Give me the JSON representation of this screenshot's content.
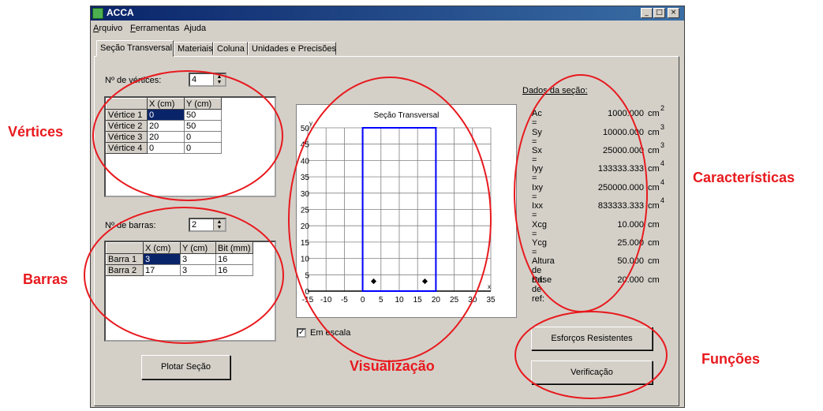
{
  "window": {
    "title": "ACCA",
    "min": "_",
    "max": "□",
    "close": "×"
  },
  "menu": [
    {
      "u": "A",
      "rest": "rquivo"
    },
    {
      "u": "F",
      "rest": "erramentas"
    },
    {
      "u": "",
      "rest": "Ajuda"
    }
  ],
  "tabs": [
    "Seção Transversal",
    "Materiais",
    "Coluna",
    "Unidades e Precisões"
  ],
  "vertices": {
    "label": "Nº de vértices:",
    "count": "4",
    "headers": [
      "",
      "X (cm)",
      "Y (cm)"
    ],
    "rows": [
      [
        "Vértice 1",
        "0",
        "50"
      ],
      [
        "Vértice 2",
        "20",
        "50"
      ],
      [
        "Vértice 3",
        "20",
        "0"
      ],
      [
        "Vértice 4",
        "0",
        "0"
      ]
    ]
  },
  "bars": {
    "label": "Nº de barras:",
    "count": "2",
    "headers": [
      "",
      "X (cm)",
      "Y (cm)",
      "Bit (mm)"
    ],
    "rows": [
      [
        "Barra 1",
        "3",
        "3",
        "16"
      ],
      [
        "Barra 2",
        "17",
        "3",
        "16"
      ]
    ]
  },
  "plot_button": "Plotar Seção",
  "scale_checkbox": {
    "label": "Em escala",
    "checked": true,
    "mark": "✓"
  },
  "chart_data": {
    "type": "scatter",
    "title": "Seção Transversal",
    "xlim": [
      -15,
      35
    ],
    "ylim": [
      0,
      50
    ],
    "xticks": [
      -15,
      -10,
      -5,
      0,
      5,
      10,
      15,
      20,
      25,
      30,
      35
    ],
    "yticks": [
      0,
      5,
      10,
      15,
      20,
      25,
      30,
      35,
      40,
      45,
      50
    ],
    "xlabel": "x",
    "ylabel": "y",
    "polygon": [
      [
        0,
        0
      ],
      [
        0,
        50
      ],
      [
        20,
        50
      ],
      [
        20,
        0
      ]
    ],
    "points": [
      [
        3,
        3
      ],
      [
        17,
        3
      ]
    ],
    "colors": {
      "polygon": "#0000ff",
      "points": "#000000",
      "grid": "#808080"
    }
  },
  "properties": {
    "title": "Dados da seção:",
    "items": [
      {
        "label": "Ac =",
        "value": "1000.000",
        "unit": "cm",
        "exp": "2"
      },
      {
        "label": "Sy =",
        "value": "10000.000",
        "unit": "cm",
        "exp": "3"
      },
      {
        "label": "Sx =",
        "value": "25000.000",
        "unit": "cm",
        "exp": "3"
      },
      {
        "label": "Iyy =",
        "value": "133333.333",
        "unit": "cm",
        "exp": "4"
      },
      {
        "label": "Ixy =",
        "value": "250000.000",
        "unit": "cm",
        "exp": "4"
      },
      {
        "label": "Ixx =",
        "value": "833333.333",
        "unit": "cm",
        "exp": "4"
      },
      {
        "label": "Xcg =",
        "value": "10.000",
        "unit": "cm",
        "exp": ""
      },
      {
        "label": "Ycg =",
        "value": "25.000",
        "unit": "cm",
        "exp": ""
      },
      {
        "label": "Altura de ref:",
        "value": "50.000",
        "unit": "cm",
        "exp": ""
      },
      {
        "label": "Base de ref:",
        "value": "20.000",
        "unit": "cm",
        "exp": ""
      }
    ]
  },
  "buttons": {
    "esforcos": "Esforços Resistentes",
    "verificacao": "Verificação"
  },
  "annotations": {
    "vertices": "Vértices",
    "barras": "Barras",
    "visualizacao": "Visualização",
    "caracteristicas": "Características",
    "funcoes": "Funções",
    "color": "#e8191e"
  }
}
